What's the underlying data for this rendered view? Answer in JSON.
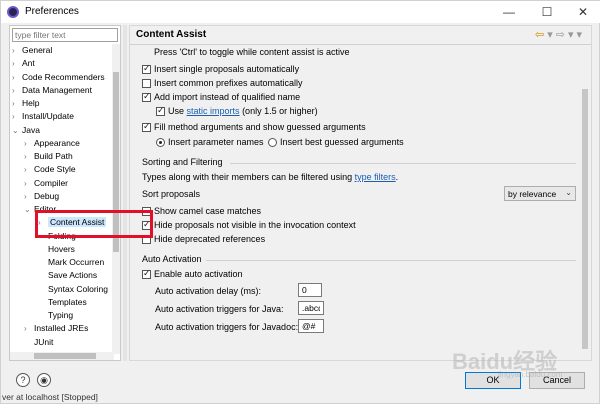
{
  "window": {
    "title": "Preferences",
    "minimize": "—",
    "maximize": "☐",
    "close": "✕"
  },
  "filter": {
    "placeholder": "type filter text"
  },
  "tree": [
    {
      "label": "General",
      "arrow": "›",
      "indent": 0
    },
    {
      "label": "Ant",
      "arrow": "›",
      "indent": 0
    },
    {
      "label": "Code Recommenders",
      "arrow": "›",
      "indent": 0
    },
    {
      "label": "Data Management",
      "arrow": "›",
      "indent": 0
    },
    {
      "label": "Help",
      "arrow": "›",
      "indent": 0
    },
    {
      "label": "Install/Update",
      "arrow": "›",
      "indent": 0
    },
    {
      "label": "Java",
      "arrow": "⌄",
      "indent": 0
    },
    {
      "label": "Appearance",
      "arrow": "›",
      "indent": 1
    },
    {
      "label": "Build Path",
      "arrow": "›",
      "indent": 1
    },
    {
      "label": "Code Style",
      "arrow": "›",
      "indent": 1
    },
    {
      "label": "Compiler",
      "arrow": "›",
      "indent": 1
    },
    {
      "label": "Debug",
      "arrow": "›",
      "indent": 1
    },
    {
      "label": "Editor",
      "arrow": "⌄",
      "indent": 1
    },
    {
      "label": "Content Assist",
      "arrow": "›",
      "indent": 2,
      "selected": true
    },
    {
      "label": "Folding",
      "arrow": "",
      "indent": 2
    },
    {
      "label": "Hovers",
      "arrow": "",
      "indent": 2
    },
    {
      "label": "Mark Occurren",
      "arrow": "",
      "indent": 2
    },
    {
      "label": "Save Actions",
      "arrow": "",
      "indent": 2
    },
    {
      "label": "Syntax Coloring",
      "arrow": "",
      "indent": 2
    },
    {
      "label": "Templates",
      "arrow": "",
      "indent": 2
    },
    {
      "label": "Typing",
      "arrow": "",
      "indent": 2
    },
    {
      "label": "Installed JREs",
      "arrow": "›",
      "indent": 1
    },
    {
      "label": "JUnit",
      "arrow": "",
      "indent": 1
    }
  ],
  "page": {
    "title": "Content Assist",
    "nav": {
      "back": "⇦",
      "back_menu": "▾",
      "forward": "⇨",
      "forward_menu": "▾",
      "menu": "▾"
    },
    "hint": "Press 'Ctrl' to toggle while content assist is active",
    "insertion": {
      "single": "Insert single proposals automatically",
      "prefixes": "Insert common prefixes automatically",
      "add_import": "Add import instead of qualified name",
      "use_prefix": "Use",
      "static_imports_link": "static imports",
      "use_suffix": "(only 1.5 or higher)",
      "fill_args": "Fill method arguments and show guessed arguments",
      "radio_params": "Insert parameter names",
      "radio_best": "Insert best guessed arguments"
    },
    "sorting": {
      "title": "Sorting and Filtering",
      "desc_prefix": "Types along with their members can be filtered using",
      "type_filters_link": "type filters",
      "desc_suffix": ".",
      "sort_label": "Sort proposals",
      "sort_value": "by relevance",
      "camel": "Show camel case matches",
      "hide_invisible": "Hide proposals not visible in the invocation context",
      "hide_deprecated": "Hide deprecated references"
    },
    "auto": {
      "title": "Auto Activation",
      "enable": "Enable auto activation",
      "delay_label": "Auto activation delay (ms):",
      "delay_value": "0",
      "java_label": "Auto activation triggers for Java:",
      "java_value": ".abcd",
      "javadoc_label": "Auto activation triggers for Javadoc:",
      "javadoc_value": "@#"
    }
  },
  "footer": {
    "help": "?",
    "import": "◉",
    "ok": "OK",
    "cancel": "Cancel"
  },
  "status": "ver at localhost [Stopped]",
  "watermark": {
    "main": "Baidu经验",
    "sub": "jingyan.baidu.com"
  }
}
